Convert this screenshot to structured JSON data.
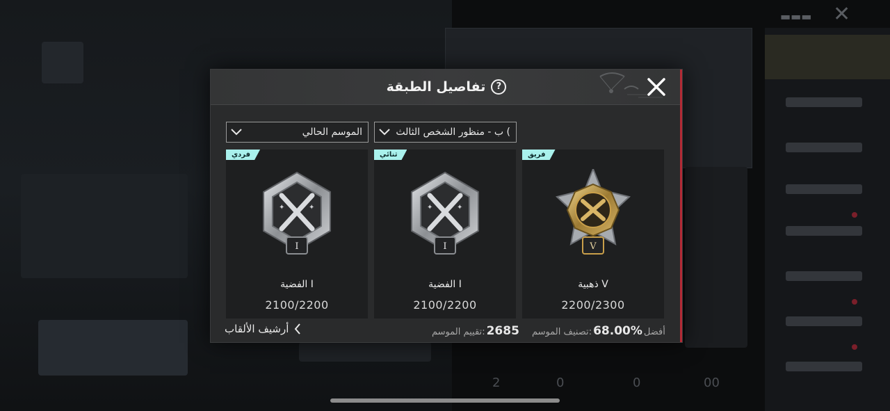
{
  "dialog": {
    "title": "تفاصيل الطبقة",
    "help_symbol": "?",
    "accent_color": "#b32a35"
  },
  "filters": {
    "mode": "ب - منظور الشخص الثالث (",
    "season": "الموسم الحالي"
  },
  "cards": [
    {
      "tag": "فردي",
      "rank": "الفضية I",
      "points": "2100/2200",
      "tier": "silver",
      "roman": "I"
    },
    {
      "tag": "ثنائي",
      "rank": "الفضية I",
      "points": "2100/2200",
      "tier": "silver",
      "roman": "I"
    },
    {
      "tag": "فريق",
      "rank": "ذهبية V",
      "points": "2200/2300",
      "tier": "gold",
      "roman": "V"
    }
  ],
  "footer": {
    "archive": "أرشيف الألقاب",
    "season_rating_label": "تقييم الموسم:",
    "season_rating_value": "2685",
    "best_rank_label": "أفضل",
    "best_rank_value": "68.00%",
    "best_rank_suffix": "تصنيف الموسم:"
  },
  "colors": {
    "tag_bg": "#a9f1ec",
    "gold": "#c9a24a",
    "silver": "#b9bcc0"
  }
}
